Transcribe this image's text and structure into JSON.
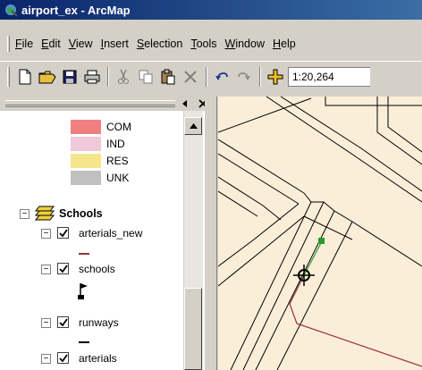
{
  "window": {
    "title": "airport_ex - ArcMap"
  },
  "menu": [
    {
      "label": "File",
      "key": "F",
      "rest": "ile"
    },
    {
      "label": "Edit",
      "key": "E",
      "rest": "dit"
    },
    {
      "label": "View",
      "key": "V",
      "rest": "iew"
    },
    {
      "label": "Insert",
      "key": "I",
      "rest": "nsert"
    },
    {
      "label": "Selection",
      "key": "S",
      "rest": "election"
    },
    {
      "label": "Tools",
      "key": "T",
      "rest": "ools"
    },
    {
      "label": "Window",
      "key": "W",
      "rest": "indow"
    },
    {
      "label": "Help",
      "key": "H",
      "rest": "elp"
    }
  ],
  "toolbar": {
    "scale": "1:20,264"
  },
  "toc": {
    "legend_items": [
      {
        "label": "COM",
        "color": "#f08080"
      },
      {
        "label": "IND",
        "color": "#f0c8d8"
      },
      {
        "label": "RES",
        "color": "#f5e68c"
      },
      {
        "label": "UNK",
        "color": "#c0c0c0"
      }
    ],
    "group_name": "Schools",
    "layers": [
      "arterials_new",
      "schools",
      "runways",
      "arterials"
    ]
  },
  "colors": {
    "map_bg": "#faeed8",
    "arterials_new_line": "#a03040",
    "start_point": "#2a9a2a"
  }
}
